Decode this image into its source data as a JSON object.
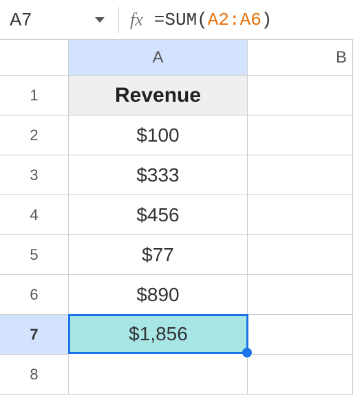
{
  "formulaBar": {
    "cellRef": "A7",
    "fxLabel": "fx",
    "formulaPrefix": "=SUM(",
    "formulaRange": "A2:A6",
    "formulaSuffix": ")"
  },
  "columns": [
    "A",
    "B"
  ],
  "rows": [
    "1",
    "2",
    "3",
    "4",
    "5",
    "6",
    "7",
    "8"
  ],
  "cells": {
    "A1": "Revenue",
    "A2": "$100",
    "A3": "$333",
    "A4": "$456",
    "A5": "$77",
    "A6": "$890",
    "A7": "$1,856"
  },
  "selectedCell": "A7",
  "chart_data": {
    "type": "table",
    "title": "Revenue",
    "categories": [
      "Row 2",
      "Row 3",
      "Row 4",
      "Row 5",
      "Row 6"
    ],
    "values": [
      100,
      333,
      456,
      77,
      890
    ],
    "sum": 1856
  }
}
